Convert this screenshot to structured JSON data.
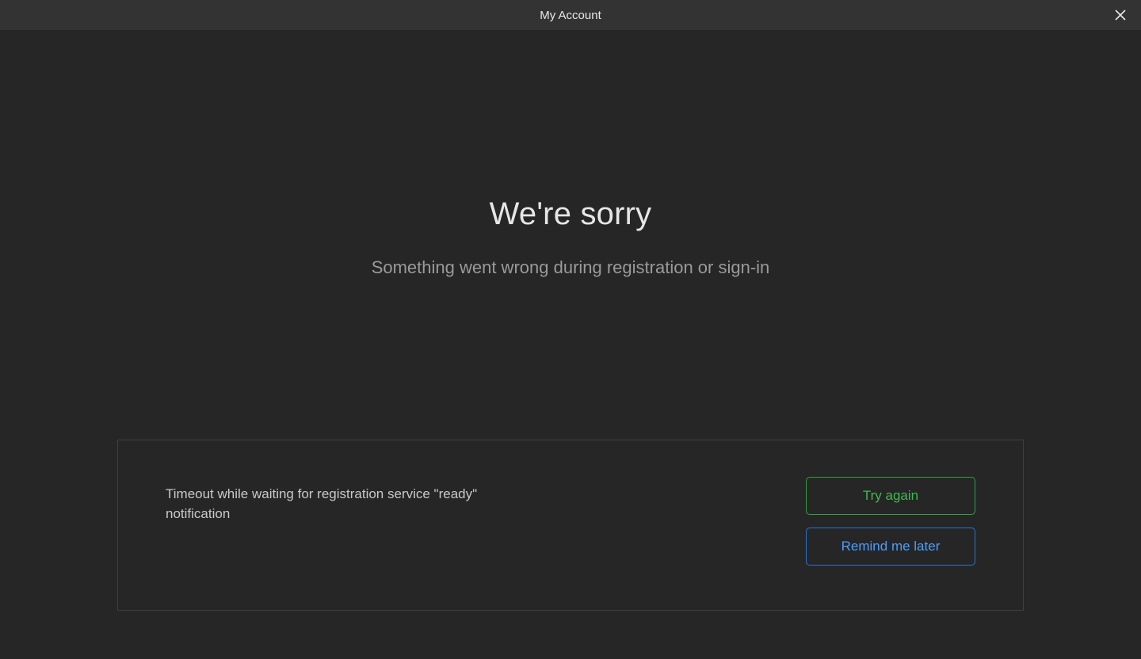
{
  "titlebar": {
    "title": "My Account"
  },
  "main": {
    "heading": "We're sorry",
    "subheading": "Something went wrong during registration or sign-in"
  },
  "error_panel": {
    "message": "Timeout while waiting for registration service \"ready\" notification",
    "try_again_label": "Try again",
    "remind_later_label": "Remind me later"
  },
  "colors": {
    "bg": "#262626",
    "titlebar_bg": "#333333",
    "border": "#3f3f3f",
    "text_primary": "#e6e6e6",
    "text_secondary": "#9a9a9a",
    "green": "#3fb950",
    "blue": "#4a9eff"
  }
}
